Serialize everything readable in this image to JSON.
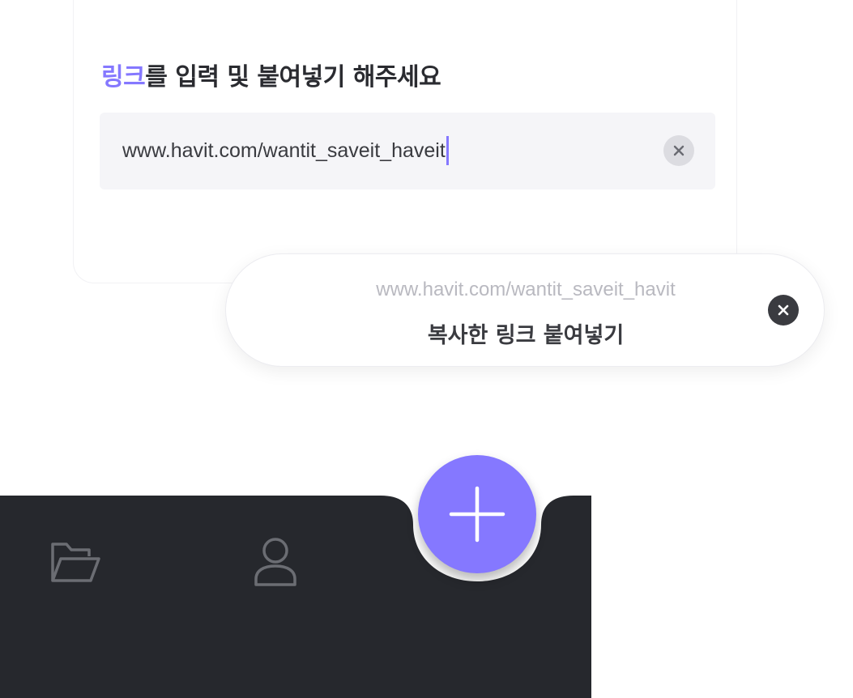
{
  "input_card": {
    "title_accent": "링크",
    "title_rest": "를 입력 및 붙여넣기 해주세요",
    "link_value": "www.havit.com/wantit_saveit_haveit",
    "clear_icon": "close-icon"
  },
  "paste_toast": {
    "url": "www.havit.com/wantit_saveit_havit",
    "label": "복사한 링크 붙여넣기",
    "close_icon": "close-icon"
  },
  "tab_bar": {
    "tabs": [
      {
        "name": "folder",
        "icon": "folder-open-icon"
      },
      {
        "name": "profile",
        "icon": "user-icon"
      }
    ],
    "fab_icon": "plus-icon"
  },
  "colors": {
    "accent": "#8578ff",
    "tab_bar_bg": "#26282d",
    "text_dark": "#2a2b30",
    "input_bg": "#f5f5f8"
  }
}
